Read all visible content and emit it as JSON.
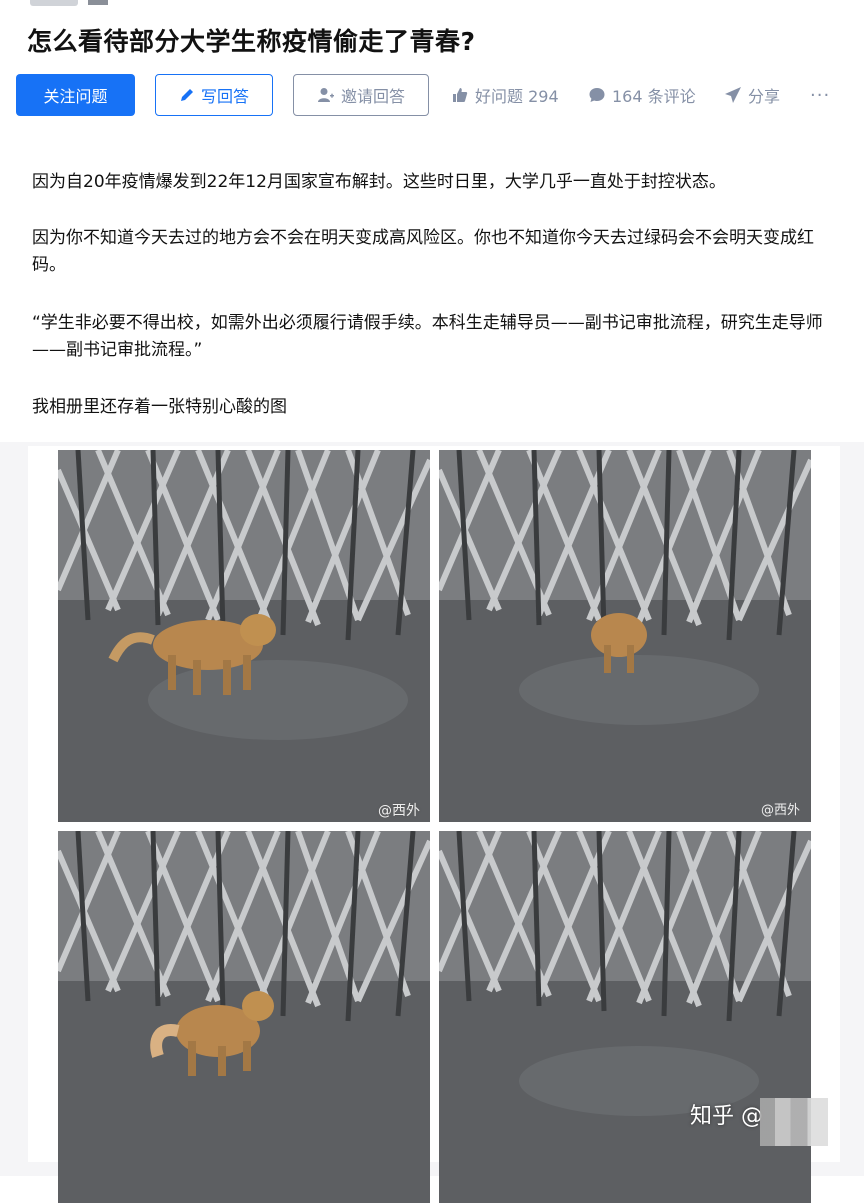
{
  "question": {
    "title": "怎么看待部分大学生称疫情偷走了青春?"
  },
  "actions": {
    "follow_label": "关注问题",
    "write_label": "写回答",
    "invite_label": "邀请回答",
    "good_question_label": "好问题 294",
    "comments_label": "164 条评论",
    "share_label": "分享",
    "more_label": "···",
    "accent_color": "#1772f6",
    "muted_color": "#8590a6"
  },
  "answer": {
    "paragraphs": [
      "因为自20年疫情爆发到22年12月国家宣布解封。这些时日里，大学几乎一直处于封控状态。",
      "因为你不知道今天去过的地方会不会在明天变成高风险区。你也不知道你今天去过绿码会不会明天变成红码。",
      "“学生非必要不得出校，如需外出必须履行请假手续。本科生走辅导员——副书记审批流程，研究生走导师——副书记审批流程。”",
      "我相册里还存着一张特别心酸的图"
    ]
  },
  "image": {
    "watermark_tr": "@西外",
    "watermark_bl": "@西外",
    "zhihu_watermark": "知乎 @"
  }
}
